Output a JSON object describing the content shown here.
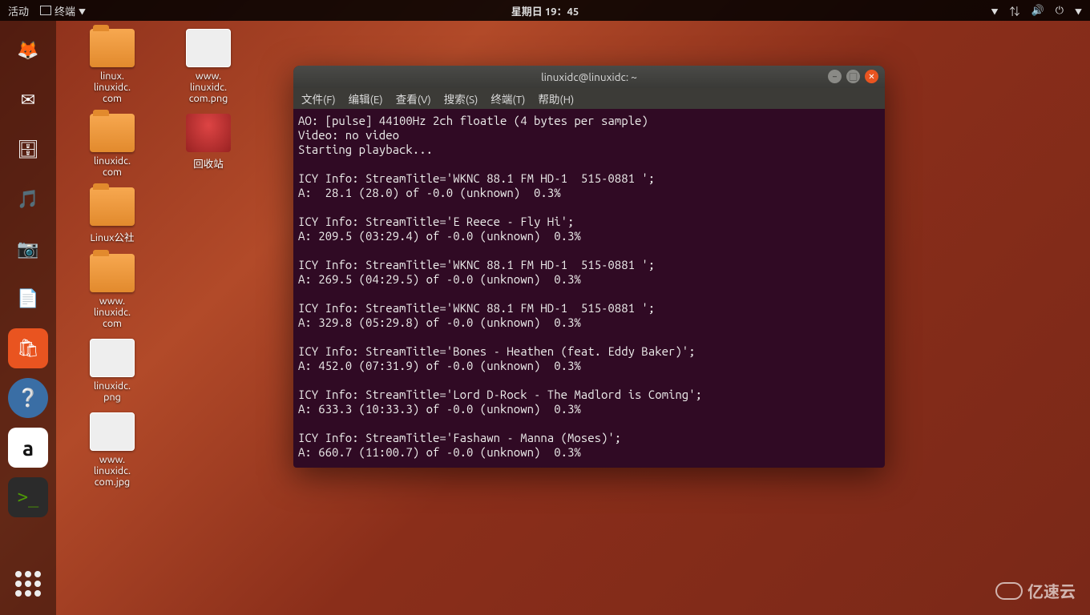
{
  "top_panel": {
    "activities": "活动",
    "app_label": "终端",
    "clock": "星期日 19：45"
  },
  "dock": {
    "items": [
      {
        "name": "firefox-icon",
        "glyph": "🦊"
      },
      {
        "name": "thunderbird-icon",
        "glyph": "✉"
      },
      {
        "name": "files-icon",
        "glyph": "🗄"
      },
      {
        "name": "rhythmbox-icon",
        "glyph": "🎵"
      },
      {
        "name": "photos-icon",
        "glyph": "📷"
      },
      {
        "name": "libreoffice-writer-icon",
        "glyph": "📄"
      },
      {
        "name": "software-icon",
        "glyph": "🛍"
      },
      {
        "name": "help-icon",
        "glyph": "❔"
      },
      {
        "name": "amazon-icon",
        "glyph": "a"
      },
      {
        "name": "terminal-icon",
        "glyph": ">_"
      }
    ]
  },
  "desktop_icons_col1": [
    {
      "kind": "folder",
      "label": "linux.\nlinuxidc.\ncom"
    },
    {
      "kind": "folder",
      "label": "linuxidc.\ncom"
    },
    {
      "kind": "folder",
      "label": "Linux公社"
    },
    {
      "kind": "folder",
      "label": "www.\nlinuxidc.\ncom"
    },
    {
      "kind": "image",
      "label": "linuxidc.\npng"
    },
    {
      "kind": "image",
      "label": "www.\nlinuxidc.\ncom.jpg"
    }
  ],
  "desktop_icons_col2": [
    {
      "kind": "image",
      "label": "www.\nlinuxidc.\ncom.png"
    },
    {
      "kind": "trash",
      "label": "回收站"
    }
  ],
  "terminal": {
    "title": "linuxidc@linuxidc: ~",
    "menu": [
      "文件(F)",
      "编辑(E)",
      "查看(V)",
      "搜索(S)",
      "终端(T)",
      "帮助(H)"
    ],
    "lines": [
      "AO: [pulse] 44100Hz 2ch floatle (4 bytes per sample)",
      "Video: no video",
      "Starting playback...",
      "",
      "ICY Info: StreamTitle='WKNC 88.1 FM HD-1  515-0881 ';",
      "A:  28.1 (28.0) of -0.0 (unknown)  0.3%",
      "",
      "ICY Info: StreamTitle='E Reece - Fly Hi';",
      "A: 209.5 (03:29.4) of -0.0 (unknown)  0.3%",
      "",
      "ICY Info: StreamTitle='WKNC 88.1 FM HD-1  515-0881 ';",
      "A: 269.5 (04:29.5) of -0.0 (unknown)  0.3%",
      "",
      "ICY Info: StreamTitle='WKNC 88.1 FM HD-1  515-0881 ';",
      "A: 329.8 (05:29.8) of -0.0 (unknown)  0.3%",
      "",
      "ICY Info: StreamTitle='Bones - Heathen (feat. Eddy Baker)';",
      "A: 452.0 (07:31.9) of -0.0 (unknown)  0.3%",
      "",
      "ICY Info: StreamTitle='Lord D-Rock - The Madlord is Coming';",
      "A: 633.3 (10:33.3) of -0.0 (unknown)  0.3%",
      "",
      "ICY Info: StreamTitle='Fashawn - Manna (Moses)';",
      "A: 660.7 (11:00.7) of -0.0 (unknown)  0.3%"
    ]
  },
  "watermark": "亿速云"
}
